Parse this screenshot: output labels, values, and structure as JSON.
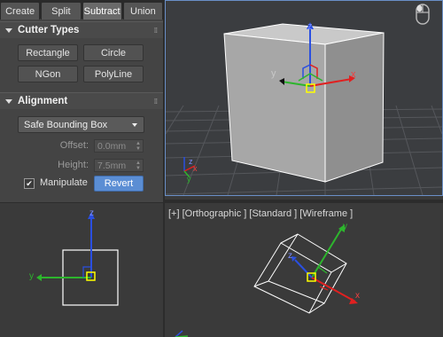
{
  "tabs": [
    {
      "label": "Create"
    },
    {
      "label": "Split"
    },
    {
      "label": "Subtract"
    },
    {
      "label": "Union"
    }
  ],
  "cutter_types": {
    "title": "Cutter Types",
    "buttons": [
      "Rectangle",
      "Circle",
      "NGon",
      "PolyLine"
    ]
  },
  "alignment": {
    "title": "Alignment",
    "dropdown_value": "Safe Bounding Box",
    "offset_label": "Offset:",
    "offset_value": "0.0mm",
    "height_label": "Height:",
    "height_value": "7.5mm",
    "manipulate_label": "Manipulate",
    "manipulate_checked": true,
    "revert_label": "Revert"
  },
  "viewport_label": "[+] [Orthographic ] [Standard ] [Wireframe ]",
  "axes": {
    "x": "x",
    "y": "y",
    "z": "z"
  },
  "icons": {
    "mouse": "mouse-icon",
    "rollout_caret": "caret-down-icon",
    "dropdown_arrow": "chevron-down-icon",
    "grip": "grip-icon"
  },
  "colors": {
    "active_viewport_border": "#6a8fc7",
    "revert_button": "#5b8ed4",
    "axis_x": "#e02020",
    "axis_y": "#2db52d",
    "axis_z": "#2a4fe0",
    "gizmo_center": "#ffff00"
  }
}
